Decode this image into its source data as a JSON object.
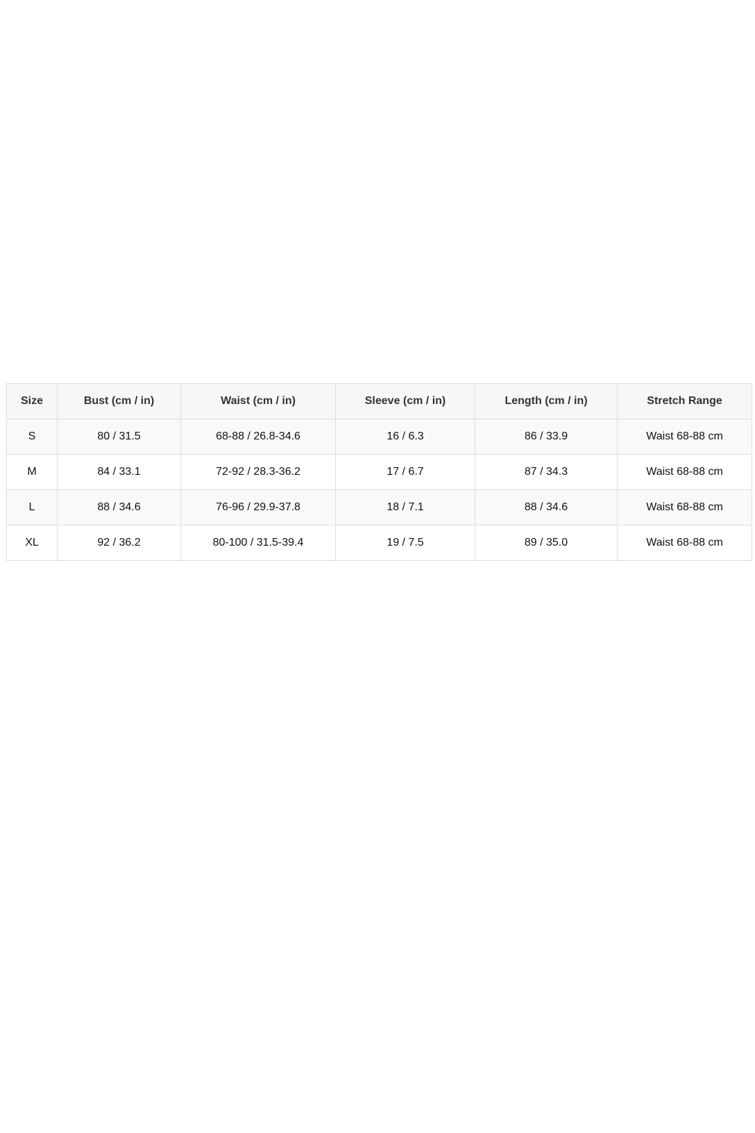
{
  "size_chart": {
    "headers": [
      "Size",
      "Bust (cm / in)",
      "Waist (cm / in)",
      "Sleeve (cm / in)",
      "Length (cm / in)",
      "Stretch Range"
    ],
    "rows": [
      [
        "S",
        "80 / 31.5",
        "68-88 / 26.8-34.6",
        "16 / 6.3",
        "86 / 33.9",
        "Waist 68-88 cm"
      ],
      [
        "M",
        "84 / 33.1",
        "72-92 / 28.3-36.2",
        "17 / 6.7",
        "87 / 34.3",
        "Waist 68-88 cm"
      ],
      [
        "L",
        "88 / 34.6",
        "76-96 / 29.9-37.8",
        "18 / 7.1",
        "88 / 34.6",
        "Waist 68-88 cm"
      ],
      [
        "XL",
        "92 / 36.2",
        "80-100 / 31.5-39.4",
        "19 / 7.5",
        "89 / 35.0",
        "Waist 68-88 cm"
      ]
    ]
  }
}
